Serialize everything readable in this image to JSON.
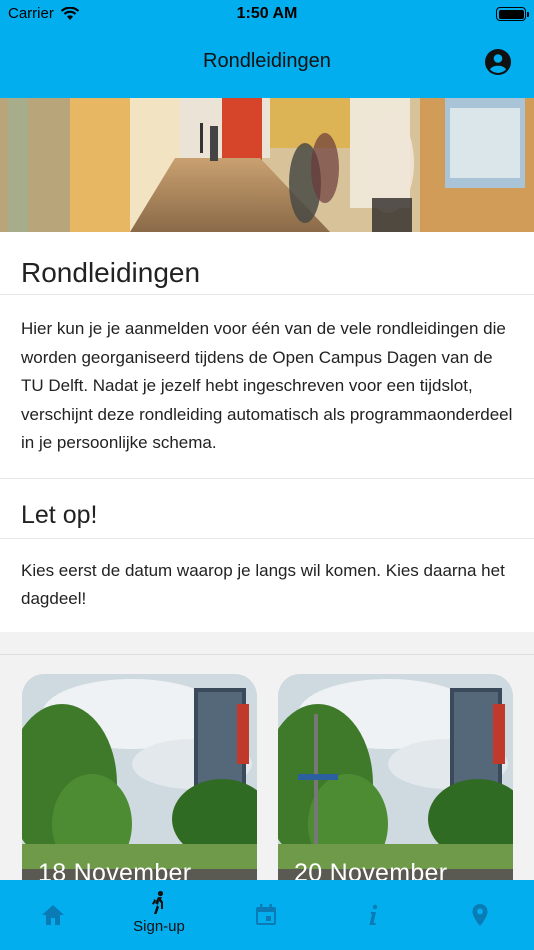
{
  "status_bar": {
    "carrier": "Carrier",
    "time": "1:50 AM"
  },
  "header": {
    "title": "Rondleidingen",
    "profile_icon": "account-circle-icon"
  },
  "content": {
    "title": "Rondleidingen",
    "intro": "Hier kun je je aanmelden voor één van de vele rondleidingen die worden georganiseerd tijdens de Open Campus Dagen van de TU Delft. Nadat je jezelf hebt ingeschreven voor een tijdslot, verschijnt deze rondleiding automatisch als programmaonderdeel in je persoonlijke schema.",
    "notice_title": "Let op!",
    "notice_text": "Kies eerst de datum waarop je langs wil komen. Kies daarna het dagdeel!"
  },
  "dates": [
    {
      "label": "18 November"
    },
    {
      "label": "20 November"
    }
  ],
  "tabs": [
    {
      "icon": "home-icon",
      "label": ""
    },
    {
      "icon": "walking-icon",
      "label": "Sign-up"
    },
    {
      "icon": "calendar-icon",
      "label": ""
    },
    {
      "icon": "info-icon",
      "label": ""
    },
    {
      "icon": "location-pin-icon",
      "label": ""
    }
  ],
  "colors": {
    "accent": "#03aeef",
    "tab_inactive": "#0a7bb5",
    "tab_active": "#111111"
  }
}
